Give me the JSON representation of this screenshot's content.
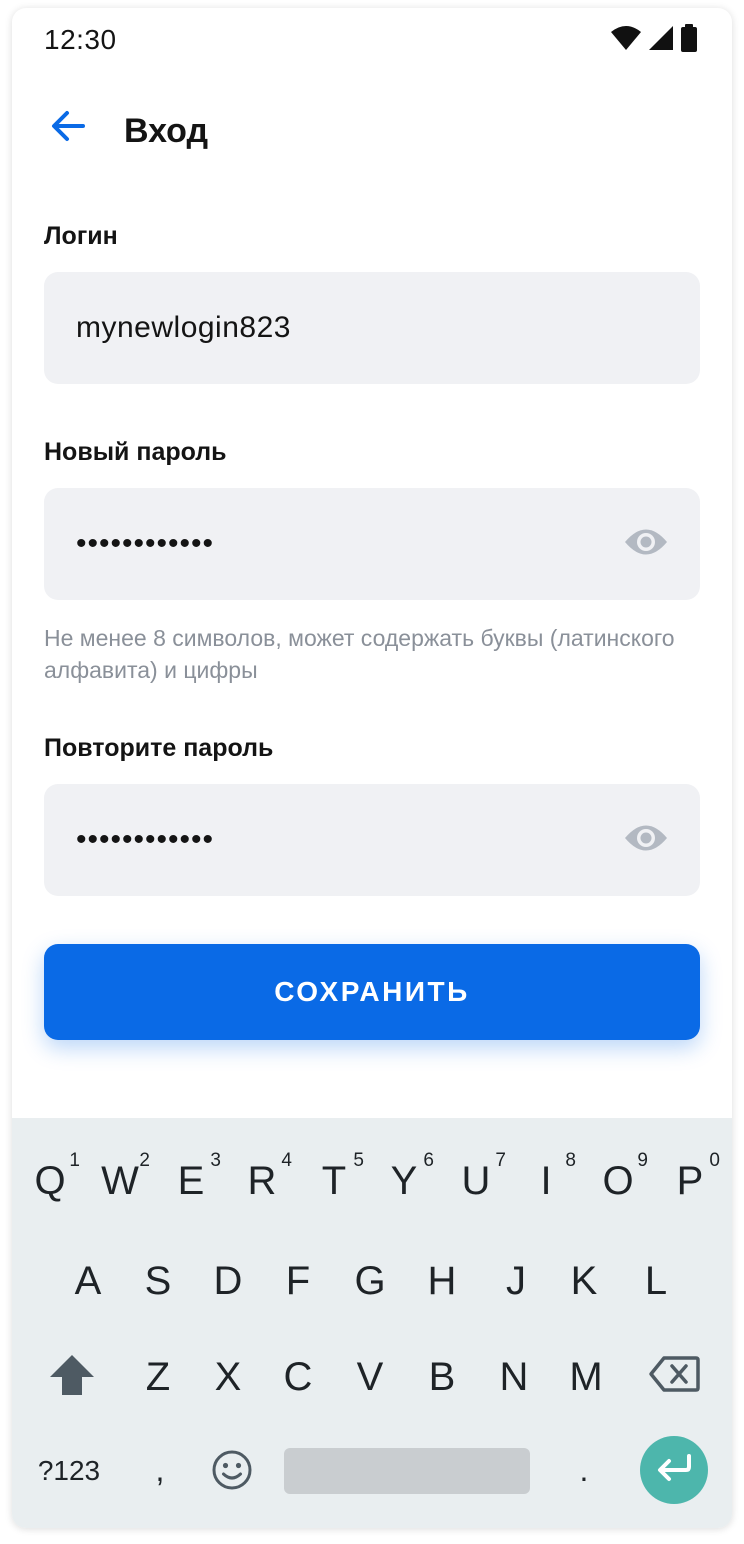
{
  "status_bar": {
    "time": "12:30",
    "wifi_icon": "wifi-icon",
    "signal_icon": "signal-icon",
    "battery_icon": "battery-icon"
  },
  "app_bar": {
    "title": "Вход",
    "back_icon": "arrow-left-icon"
  },
  "form": {
    "login": {
      "label": "Логин",
      "value": "mynewlogin823"
    },
    "new_password": {
      "label": "Новый пароль",
      "value": "••••••••••••",
      "hint": "Не менее 8 символов, может содержать буквы (латинского алфавита) и цифры"
    },
    "repeat_password": {
      "label": "Повторите пароль",
      "value": "••••••••••••"
    },
    "save_label": "СОХРАНИТЬ"
  },
  "keyboard": {
    "row1": [
      {
        "key": "Q",
        "num": "1"
      },
      {
        "key": "W",
        "num": "2"
      },
      {
        "key": "E",
        "num": "3"
      },
      {
        "key": "R",
        "num": "4"
      },
      {
        "key": "T",
        "num": "5"
      },
      {
        "key": "Y",
        "num": "6"
      },
      {
        "key": "U",
        "num": "7"
      },
      {
        "key": "I",
        "num": "8"
      },
      {
        "key": "O",
        "num": "9"
      },
      {
        "key": "P",
        "num": "0"
      }
    ],
    "row2": [
      "A",
      "S",
      "D",
      "F",
      "G",
      "H",
      "J",
      "K",
      "L"
    ],
    "row3": [
      "Z",
      "X",
      "C",
      "V",
      "B",
      "N",
      "M"
    ],
    "symbols_label": "?123",
    "comma_label": ",",
    "period_label": "."
  },
  "colors": {
    "accent": "#0a6ae6",
    "input_bg": "#f0f1f4",
    "hint_text": "#8a9099",
    "keyboard_bg": "#e9eef0",
    "enter_key": "#4db6ac"
  }
}
